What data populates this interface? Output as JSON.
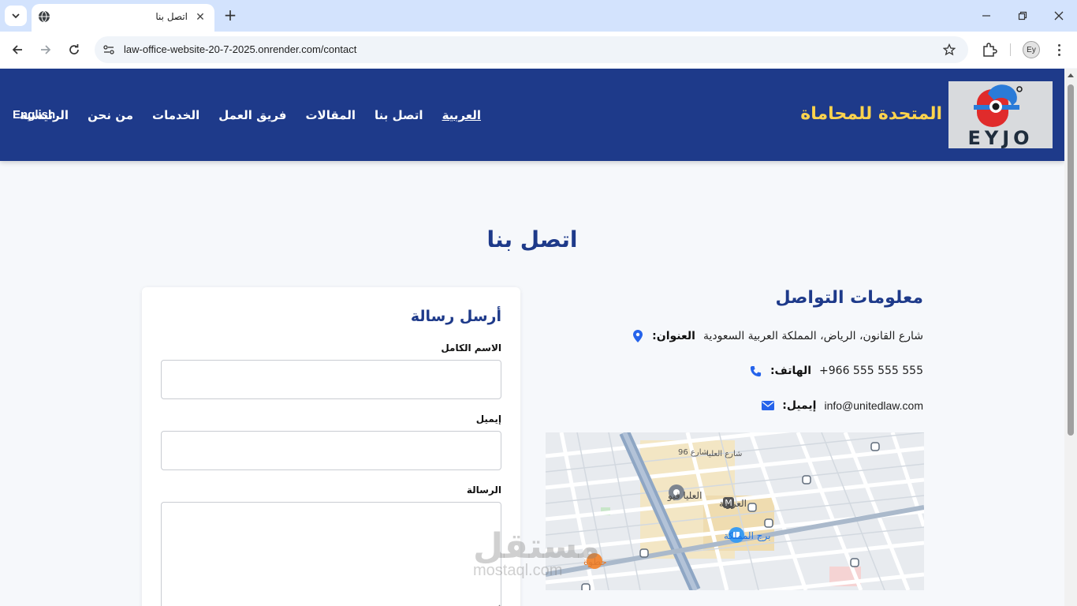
{
  "browser": {
    "tab_title": "اتصل بنا",
    "url": "law-office-website-20-7-2025.onrender.com/contact",
    "profile_initials": "Ey"
  },
  "site": {
    "logo_text": "EYJO",
    "brand_name": "المتحدة للمحاماة",
    "nav": [
      "الرئيسية",
      "من نحن",
      "الخدمات",
      "فريق العمل",
      "المقالات",
      "اتصل بنا",
      "العربية"
    ],
    "lang_switch": "English",
    "accent_color": "#1e3a8a",
    "brand_color": "#fcd34d"
  },
  "page": {
    "title": "اتصل بنا"
  },
  "contact_info": {
    "title": "معلومات التواصل",
    "address_label": "العنوان:",
    "address_value": "شارع القانون، الرياض، المملكة العربية السعودية",
    "phone_label": "الهاتف:",
    "phone_value": "+966 555 555 555",
    "email_label": "إيميل:",
    "email_value": "info@unitedlaw.com"
  },
  "map": {
    "labels": [
      "برج المملكة",
      "العليا فيو",
      "العروبة",
      "شارع العليا",
      "شارع 96",
      "حطوة"
    ]
  },
  "form": {
    "title": "أرسل رسالة",
    "name_label": "الاسم الكامل",
    "email_label": "إيميل",
    "message_label": "الرسالة"
  },
  "watermark": {
    "ar": "مستقل",
    "en": "mostaql.com"
  }
}
